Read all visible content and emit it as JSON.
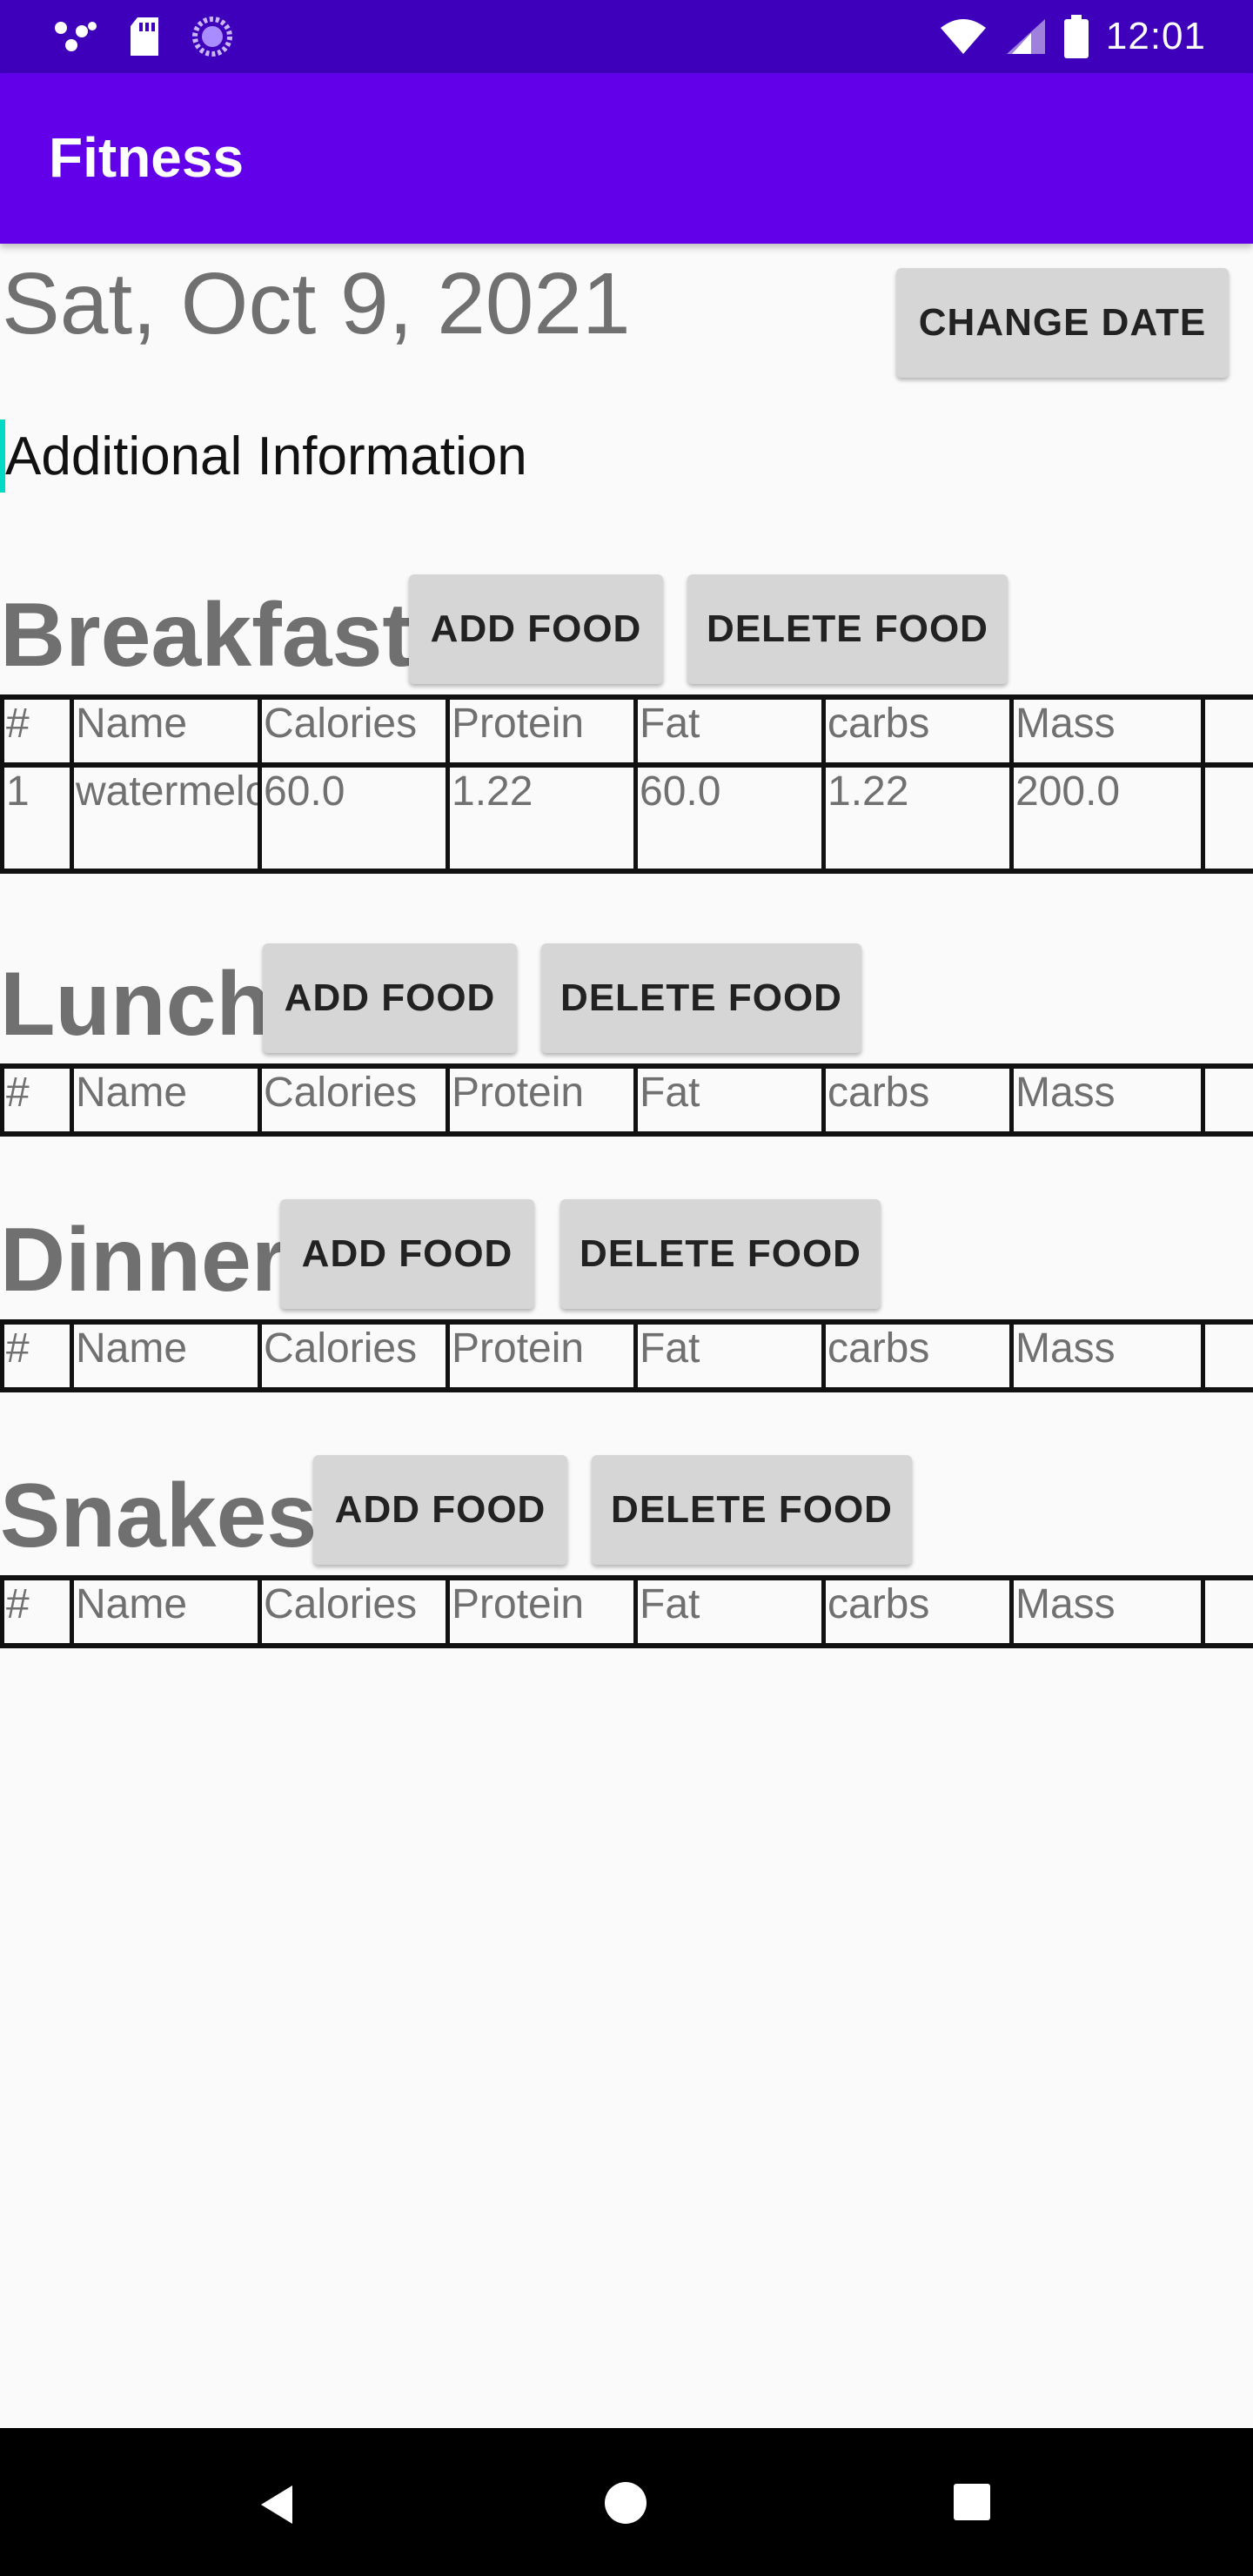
{
  "status_bar": {
    "time": "12:01"
  },
  "app": {
    "title": "Fitness"
  },
  "date": {
    "label": "Sat, Oct 9, 2021",
    "change_button": "CHANGE DATE"
  },
  "additional_info": {
    "text": "Additional Information"
  },
  "columns": [
    "#",
    "Name",
    "Calories",
    "Protein",
    "Fat",
    "carbs",
    "Mass",
    ""
  ],
  "meals": [
    {
      "title": "Breakfast",
      "add_label": "ADD FOOD",
      "delete_label": "DELETE FOOD",
      "rows": [
        [
          "1",
          "watermelon",
          "60.0",
          "1.22",
          "60.0",
          "1.22",
          "200.0",
          ""
        ]
      ]
    },
    {
      "title": "Lunch",
      "add_label": "ADD FOOD",
      "delete_label": "DELETE FOOD",
      "rows": []
    },
    {
      "title": "Dinner",
      "add_label": "ADD FOOD",
      "delete_label": "DELETE FOOD",
      "rows": []
    },
    {
      "title": "Snakes",
      "add_label": "ADD FOOD",
      "delete_label": "DELETE FOOD",
      "rows": []
    }
  ],
  "icons": {
    "status_left": [
      "notification-dots-icon",
      "sd-card-icon",
      "sync-icon"
    ],
    "status_right": [
      "wifi-icon",
      "cell-signal-icon",
      "battery-icon"
    ],
    "nav": [
      "back-icon",
      "home-icon",
      "recent-apps-icon"
    ]
  }
}
